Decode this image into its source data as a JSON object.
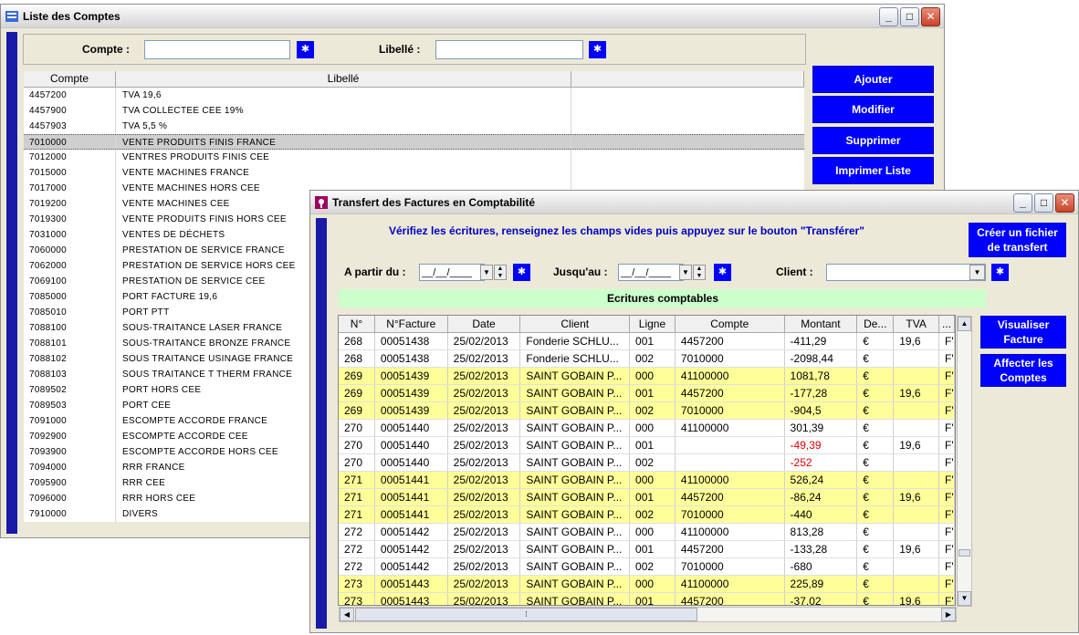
{
  "win1": {
    "title": "Liste des Comptes",
    "filter_compte_label": "Compte :",
    "filter_libelle_label": "Libellé :",
    "filter_compte_value": "",
    "filter_libelle_value": "",
    "headers": [
      "Compte",
      "Libellé",
      ""
    ],
    "buttons": [
      "Ajouter",
      "Modifier",
      "Supprimer",
      "Imprimer Liste"
    ],
    "rows": [
      [
        "4457200",
        "TVA 19,6"
      ],
      [
        "4457900",
        "TVA COLLECTEE CEE 19%"
      ],
      [
        "4457903",
        "TVA 5,5 %"
      ],
      [
        "7010000",
        "VENTE PRODUITS FINIS FRANCE"
      ],
      [
        "7012000",
        "VENTRES PRODUITS FINIS CEE"
      ],
      [
        "7015000",
        "VENTE MACHINES FRANCE"
      ],
      [
        "7017000",
        "VENTE MACHINES HORS CEE"
      ],
      [
        "7019200",
        "VENTE MACHINES CEE"
      ],
      [
        "7019300",
        "VENTE PRODUITS FINIS HORS CEE"
      ],
      [
        "7031000",
        "VENTES DE DÉCHETS"
      ],
      [
        "7060000",
        "PRESTATION DE SERVICE FRANCE"
      ],
      [
        "7062000",
        "PRESTATION DE SERVICE HORS CEE"
      ],
      [
        "7069100",
        "PRESTATION DE SERVICE CEE"
      ],
      [
        "7085000",
        "PORT FACTURE 19,6"
      ],
      [
        "7085010",
        "PORT PTT"
      ],
      [
        "7088100",
        "SOUS-TRAITANCE LASER FRANCE"
      ],
      [
        "7088101",
        "SOUS-TRAITANCE BRONZE FRANCE"
      ],
      [
        "7088102",
        "SOUS TRAITANCE USINAGE FRANCE"
      ],
      [
        "7088103",
        "SOUS TRAITANCE T THERM FRANCE"
      ],
      [
        "7089502",
        "PORT HORS CEE"
      ],
      [
        "7089503",
        "PORT CEE"
      ],
      [
        "7091000",
        "ESCOMPTE ACCORDE FRANCE"
      ],
      [
        "7092900",
        "ESCOMPTE ACCORDE CEE"
      ],
      [
        "7093900",
        "ESCOMPTE ACCORDE HORS CEE"
      ],
      [
        "7094000",
        "RRR FRANCE"
      ],
      [
        "7095900",
        "RRR CEE"
      ],
      [
        "7096000",
        "RRR HORS CEE"
      ],
      [
        "7910000",
        "DIVERS"
      ]
    ],
    "selected_index": 3
  },
  "win2": {
    "title": "Transfert des Factures en Comptabilité",
    "instruction": "Vérifiez les écritures, renseignez les champs vides puis appuyez sur le bouton \"Transférer\"",
    "btn_create": "Créer un fichier de transfert",
    "label_from": "A partir du :",
    "label_to": "Jusqu'au :",
    "label_client": "Client :",
    "date_from": "__/__/____",
    "date_to": "__/__/____",
    "client_value": "",
    "section_title": "Ecritures comptables",
    "btn_visualiser": "Visualiser Facture",
    "btn_affecter": "Affecter les Comptes",
    "headers": [
      "N°",
      "N°Facture",
      "Date",
      "Client",
      "Ligne",
      "Compte",
      "Montant",
      "De...",
      "TVA",
      "..."
    ],
    "rows": [
      {
        "y": false,
        "c": [
          "268",
          "00051438",
          "25/02/2013",
          "Fonderie SCHLU...",
          "001",
          "4457200",
          "-411,29",
          "€",
          "19,6",
          "F'"
        ]
      },
      {
        "y": false,
        "c": [
          "268",
          "00051438",
          "25/02/2013",
          "Fonderie SCHLU...",
          "002",
          "7010000",
          "-2098,44",
          "€",
          "",
          "F'"
        ]
      },
      {
        "y": true,
        "c": [
          "269",
          "00051439",
          "25/02/2013",
          "SAINT GOBAIN P...",
          "000",
          "41100000",
          "1081,78",
          "€",
          "",
          "F'"
        ]
      },
      {
        "y": true,
        "c": [
          "269",
          "00051439",
          "25/02/2013",
          "SAINT GOBAIN P...",
          "001",
          "4457200",
          "-177,28",
          "€",
          "19,6",
          "F'"
        ]
      },
      {
        "y": true,
        "c": [
          "269",
          "00051439",
          "25/02/2013",
          "SAINT GOBAIN P...",
          "002",
          "7010000",
          "-904,5",
          "€",
          "",
          "F'"
        ]
      },
      {
        "y": false,
        "c": [
          "270",
          "00051440",
          "25/02/2013",
          "SAINT GOBAIN P...",
          "000",
          "41100000",
          "301,39",
          "€",
          "",
          "F'"
        ]
      },
      {
        "y": false,
        "neg": true,
        "c": [
          "270",
          "00051440",
          "25/02/2013",
          "SAINT GOBAIN P...",
          "001",
          "",
          "-49,39",
          "€",
          "19,6",
          "F'"
        ]
      },
      {
        "y": false,
        "neg": true,
        "c": [
          "270",
          "00051440",
          "25/02/2013",
          "SAINT GOBAIN P...",
          "002",
          "",
          "-252",
          "€",
          "",
          "F'"
        ]
      },
      {
        "y": true,
        "c": [
          "271",
          "00051441",
          "25/02/2013",
          "SAINT GOBAIN P...",
          "000",
          "41100000",
          "526,24",
          "€",
          "",
          "F'"
        ]
      },
      {
        "y": true,
        "c": [
          "271",
          "00051441",
          "25/02/2013",
          "SAINT GOBAIN P...",
          "001",
          "4457200",
          "-86,24",
          "€",
          "19,6",
          "F'"
        ]
      },
      {
        "y": true,
        "c": [
          "271",
          "00051441",
          "25/02/2013",
          "SAINT GOBAIN P...",
          "002",
          "7010000",
          "-440",
          "€",
          "",
          "F'"
        ]
      },
      {
        "y": false,
        "c": [
          "272",
          "00051442",
          "25/02/2013",
          "SAINT GOBAIN P...",
          "000",
          "41100000",
          "813,28",
          "€",
          "",
          "F'"
        ]
      },
      {
        "y": false,
        "c": [
          "272",
          "00051442",
          "25/02/2013",
          "SAINT GOBAIN P...",
          "001",
          "4457200",
          "-133,28",
          "€",
          "19,6",
          "F'"
        ]
      },
      {
        "y": false,
        "c": [
          "272",
          "00051442",
          "25/02/2013",
          "SAINT GOBAIN P...",
          "002",
          "7010000",
          "-680",
          "€",
          "",
          "F'"
        ]
      },
      {
        "y": true,
        "c": [
          "273",
          "00051443",
          "25/02/2013",
          "SAINT GOBAIN P...",
          "000",
          "41100000",
          "225,89",
          "€",
          "",
          "F'"
        ]
      },
      {
        "y": true,
        "c": [
          "273",
          "00051443",
          "25/02/2013",
          "SAINT GOBAIN P...",
          "001",
          "4457200",
          "-37,02",
          "€",
          "19,6",
          "F'"
        ]
      }
    ]
  },
  "colors": {
    "accent": "#0000ff",
    "sidebar": "#1a1aa8",
    "highlight_row": "#ffff99",
    "section_bg": "#ccffcc",
    "negative": "#e00000"
  }
}
